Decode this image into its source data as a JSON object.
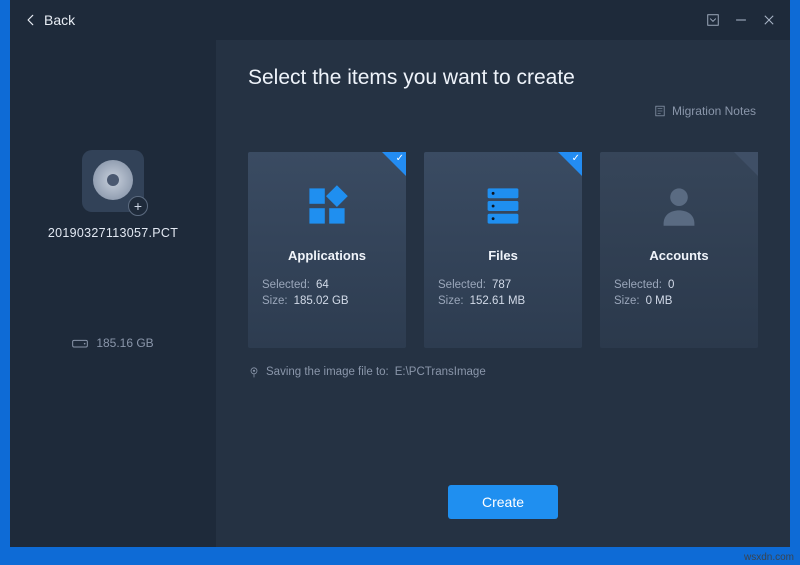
{
  "topbar": {
    "back_label": "Back"
  },
  "sidebar": {
    "filename": "20190327113057.PCT",
    "disk_space": "185.16 GB"
  },
  "content": {
    "title": "Select the items you want to create",
    "notes_link": "Migration Notes",
    "footnote_prefix": "Saving the image file to:",
    "footnote_path": "E:\\PCTransImage",
    "create_label": "Create",
    "cards": [
      {
        "title": "Applications",
        "selected_label": "Selected:",
        "selected_value": "64",
        "size_label": "Size:",
        "size_value": "185.02 GB",
        "checked": true
      },
      {
        "title": "Files",
        "selected_label": "Selected:",
        "selected_value": "787",
        "size_label": "Size:",
        "size_value": "152.61 MB",
        "checked": true
      },
      {
        "title": "Accounts",
        "selected_label": "Selected:",
        "selected_value": "0",
        "size_label": "Size:",
        "size_value": "0 MB",
        "checked": false
      }
    ]
  },
  "watermark": "wsxdn.com"
}
